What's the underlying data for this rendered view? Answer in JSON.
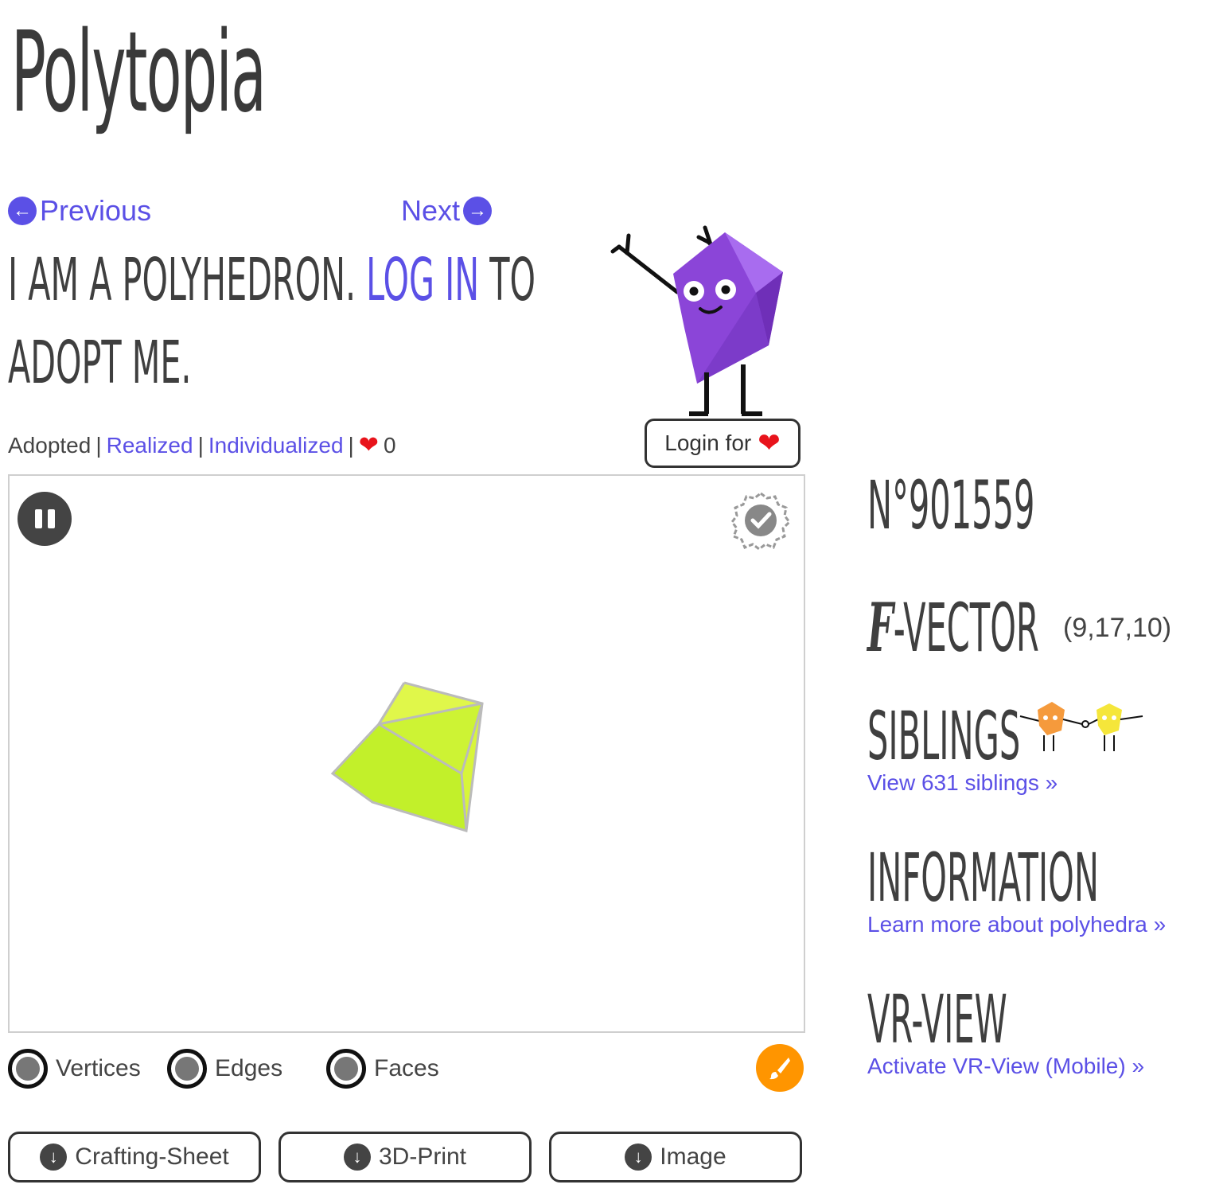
{
  "site": {
    "title": "Polytopia"
  },
  "nav": {
    "previous": "Previous",
    "next": "Next"
  },
  "intro": {
    "part1": "I am a polyhedron.",
    "login_link": "Log in",
    "part2": "to",
    "part3": "adopt me."
  },
  "status": {
    "adopted": "Adopted",
    "realized": "Realized",
    "individualized": "Individualized",
    "separator": "|",
    "likes": "0"
  },
  "login_fav": {
    "label": "Login for"
  },
  "controls": {
    "vertices": "Vertices",
    "edges": "Edges",
    "faces": "Faces"
  },
  "downloads": {
    "crafting": "Crafting-Sheet",
    "print3d": "3D-Print",
    "image": "Image"
  },
  "sidebar": {
    "number": "N°901559",
    "fvector_label": "-Vector",
    "fvector_symbol": "f",
    "fvector_value": "(9,17,10)",
    "siblings_heading": "Siblings",
    "siblings_link": "View 631 siblings »",
    "information_heading": "Information",
    "information_link": "Learn more about polyhedra »",
    "vr_heading": "VR-View",
    "vr_link": "Activate VR-View (Mobile) »"
  },
  "colors": {
    "link": "#5b50e6",
    "polyhedron": "#c6f22b",
    "mascot": "#8b45d8",
    "heart": "#e8131b",
    "paint_button": "#ff9500"
  },
  "icons": {
    "previous": "arrow-circle-left-icon",
    "next": "arrow-circle-right-icon",
    "pause": "pause-icon",
    "verified": "verified-badge-icon",
    "paint": "paintbrush-icon",
    "download": "download-icon",
    "heart": "heart-icon"
  }
}
